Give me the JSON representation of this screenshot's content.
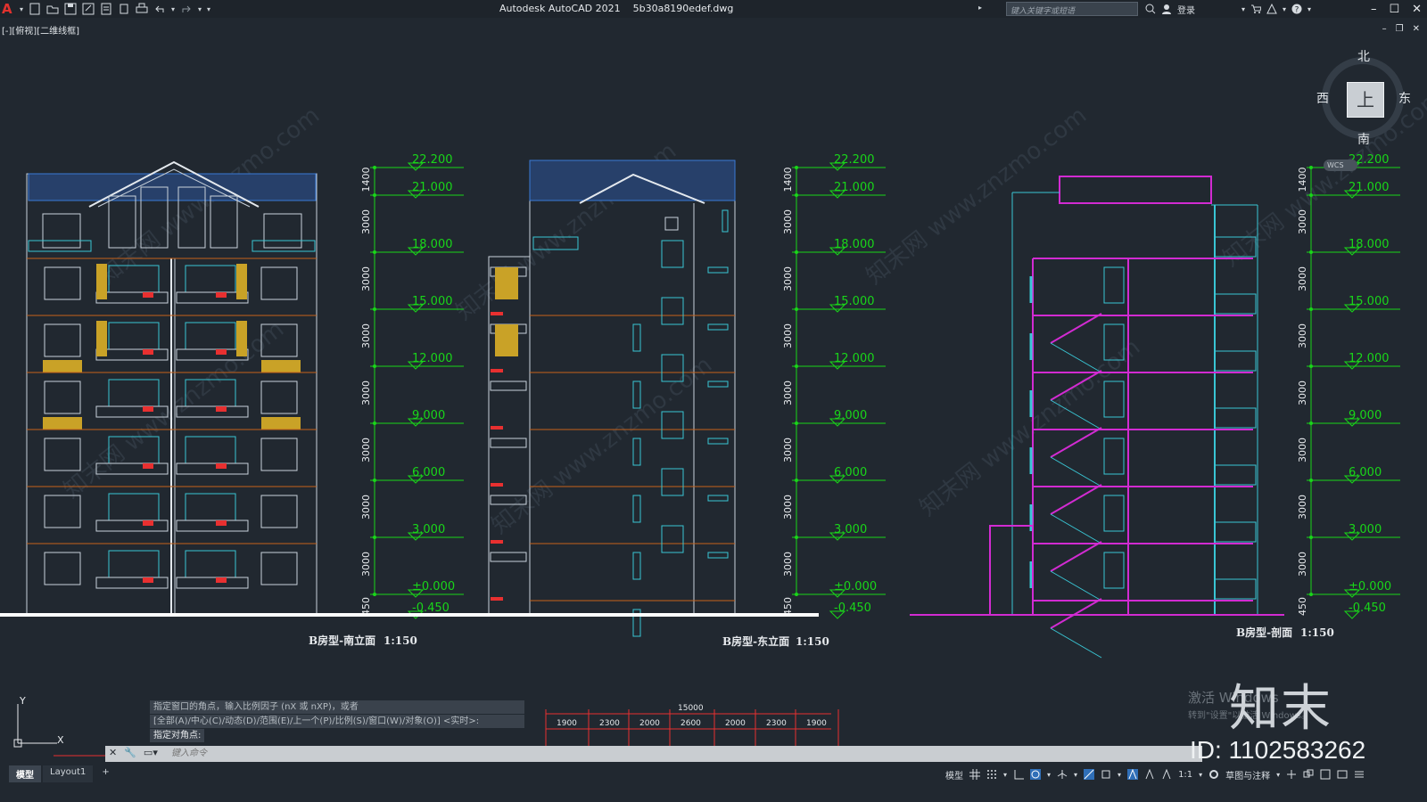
{
  "titlebar": {
    "app_name": "Autodesk AutoCAD 2021",
    "file_name": "5b30a8190edef.dwg",
    "search_placeholder": "键入关键字或短语",
    "login_label": "登录"
  },
  "viewport": {
    "view_label": "[-][俯视][二维线框]"
  },
  "viewcube": {
    "north": "北",
    "south": "南",
    "west": "西",
    "east": "东",
    "top_face": "上",
    "wcs": "WCS"
  },
  "drawing": {
    "elevation_south_title": "B房型-南立面",
    "elevation_east_title": "B房型-东立面",
    "section_title": "B房型-剖面",
    "scale": "1:150",
    "level_marks": [
      "22.200",
      "21.000",
      "18.000",
      "15.000",
      "12.000",
      "9.000",
      "6.000",
      "3.000",
      "±0.000",
      "-0.450"
    ],
    "vertical_dims": [
      "1400",
      "3000",
      "3000",
      "3000",
      "3000",
      "3000",
      "3000",
      "3000",
      "450"
    ],
    "bottom_total": "15000",
    "bottom_dims": [
      "1900",
      "2300",
      "2000",
      "2600",
      "2000",
      "2300",
      "1900"
    ],
    "bottom_dims_partial": [
      "1900",
      "2300",
      "2600",
      "2000",
      "2300",
      "1900"
    ],
    "bottom_dim_partial_left": "1900",
    "watermark": "www.znzmo.com",
    "watermark_cn": "知末网"
  },
  "command": {
    "history": [
      "指定窗口的角点，输入比例因子 (nX 或 nXP)，或者",
      "[全部(A)/中心(C)/动态(D)/范围(E)/上一个(P)/比例(S)/窗口(W)/对象(O)] <实时>:",
      "指定对角点:"
    ],
    "input_placeholder": "键入命令"
  },
  "tabs": [
    "模型",
    "Layout1",
    "+"
  ],
  "statusbar": {
    "model_label": "模型",
    "scale_label": "1:1",
    "workspace_label": "草图与注释"
  },
  "overlay": {
    "activate_windows": "激活 Windows",
    "activate_windows_sub": "转到\"设置\"以激活 Windows。",
    "brand": "知末",
    "id_text": "ID: 1102583262"
  },
  "colors": {
    "background": "#212830",
    "level_green": "#19d619",
    "dim_red": "#e83030",
    "cyan": "#39c6d4",
    "magenta": "#d22bd2",
    "orange": "#c8621a",
    "yellow": "#c9a227",
    "building_white": "#c9d2db"
  },
  "icons": [
    "autocad-logo",
    "new-icon",
    "open-icon",
    "save-icon",
    "saveas-icon",
    "plot-icon",
    "undo-icon",
    "redo-icon",
    "search-icon",
    "user-icon",
    "cart-icon",
    "help-icon",
    "minimize-icon",
    "maximize-icon",
    "close-icon"
  ]
}
